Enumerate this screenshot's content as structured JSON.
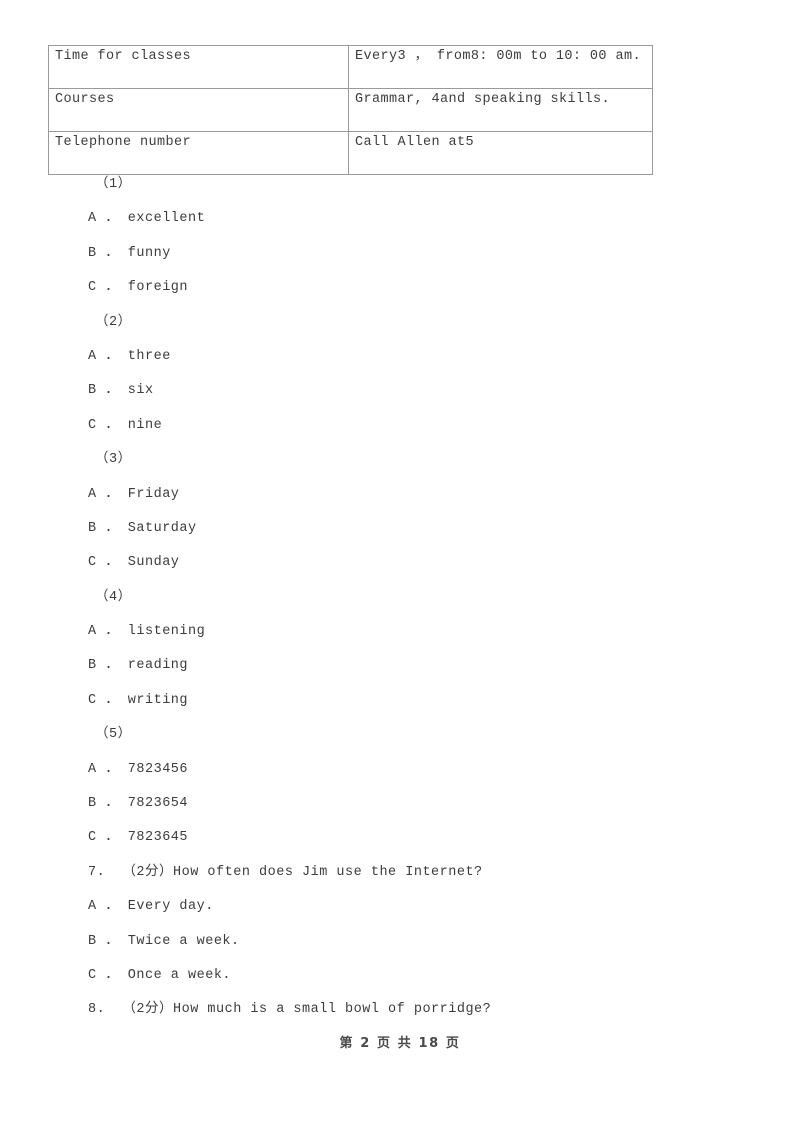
{
  "document": {
    "table": {
      "rows": [
        {
          "label": "Time for classes",
          "value": "Every3 ，  from8: 00m to 10: 00 am."
        },
        {
          "label": "Courses",
          "value": "Grammar, 4and speaking skills."
        },
        {
          "label": "Telephone number",
          "value": "Call Allen at5"
        }
      ]
    },
    "sub_questions": [
      {
        "number": "（1）",
        "options": [
          "A ． excellent",
          "B ． funny",
          "C ． foreign"
        ]
      },
      {
        "number": "（2）",
        "options": [
          "A ． three",
          "B ． six",
          "C ． nine"
        ]
      },
      {
        "number": "（3）",
        "options": [
          "A ． Friday",
          "B ． Saturday",
          "C ． Sunday"
        ]
      },
      {
        "number": "（4）",
        "options": [
          "A ． listening",
          "B ． reading",
          "C ． writing"
        ]
      },
      {
        "number": "（5）",
        "options": [
          "A ． 7823456",
          "B ． 7823654",
          "C ． 7823645"
        ]
      }
    ],
    "questions": [
      {
        "stem": "7.  （2分）How often does Jim use the Internet?",
        "options": [
          "A ． Every day.",
          "B ． Twice a week.",
          "C ． Once a week."
        ]
      },
      {
        "stem": "8.  （2分）How much is a small bowl of porridge?",
        "options": []
      }
    ],
    "footer": "第 2 页 共 18 页"
  }
}
